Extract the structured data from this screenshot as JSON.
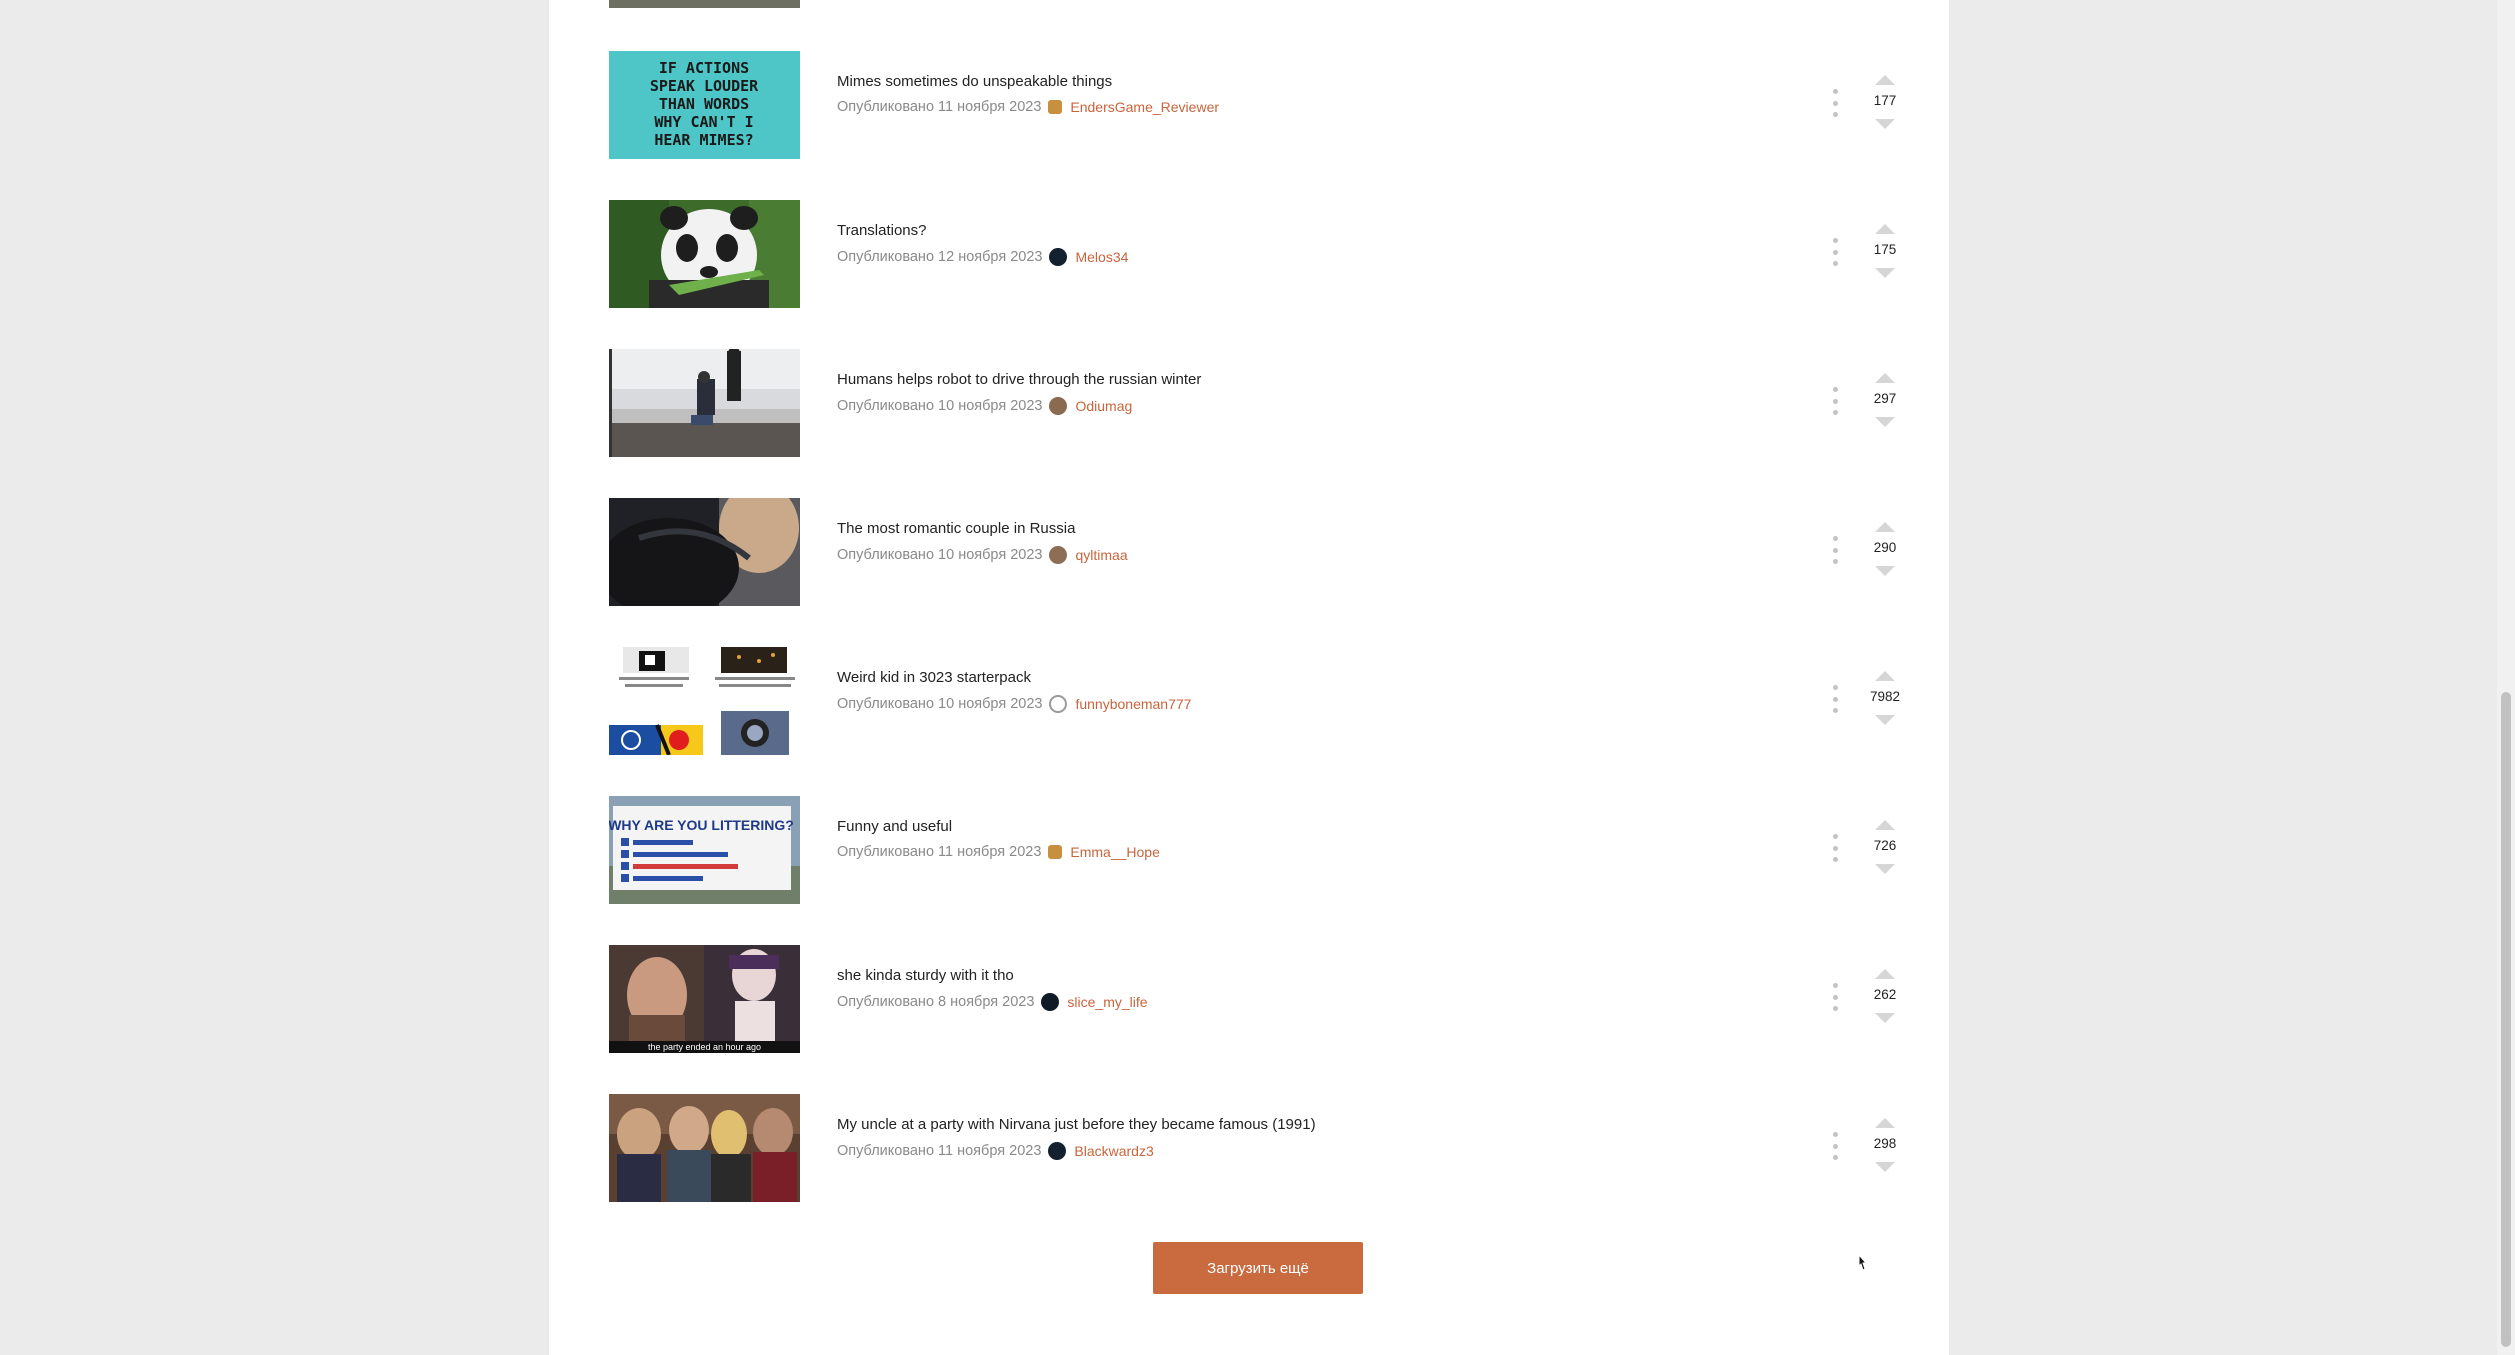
{
  "feed": {
    "posts": [
      {
        "title": "Mimes sometimes do unspeakable things",
        "date": "Опубликовано 11 ноября 2023",
        "user": "EndersGame_Reviewer",
        "score": "177",
        "thumb_text": "IF ACTIONS\nSPEAK LOUDER\nTHAN WORDS\nWHY CAN'T I\nHEAR MIMES?"
      },
      {
        "title": "Translations?",
        "date": "Опубликовано 12 ноября 2023",
        "user": "Melos34",
        "score": "175"
      },
      {
        "title": "Humans helps robot to drive through the russian winter",
        "date": "Опубликовано 10 ноября 2023",
        "user": "Odiumag",
        "score": "297"
      },
      {
        "title": "The most romantic couple in Russia",
        "date": "Опубликовано 10 ноября 2023",
        "user": "qyltimaa",
        "score": "290"
      },
      {
        "title": "Weird kid in 3023 starterpack",
        "date": "Опубликовано 10 ноября 2023",
        "user": "funnyboneman777",
        "score": "7982"
      },
      {
        "title": "Funny and useful",
        "date": "Опубликовано 11 ноября 2023",
        "user": "Emma__Hope",
        "score": "726",
        "thumb_text": "WHY ARE YOU LITTERING?"
      },
      {
        "title": "she kinda sturdy with it tho",
        "date": "Опубликовано 8 ноября 2023",
        "user": "slice_my_life",
        "score": "262",
        "thumb_text": "the party ended an hour ago"
      },
      {
        "title": "My uncle at a party with Nirvana just before they became famous (1991)",
        "date": "Опубликовано 11 ноября 2023",
        "user": "Blackwardz3",
        "score": "298"
      }
    ],
    "load_more_label": "Загрузить ещё"
  },
  "colors": {
    "accent": "#c96a3f",
    "username": "#c8643c",
    "background": "#ebebeb",
    "panel": "#ffffff"
  }
}
